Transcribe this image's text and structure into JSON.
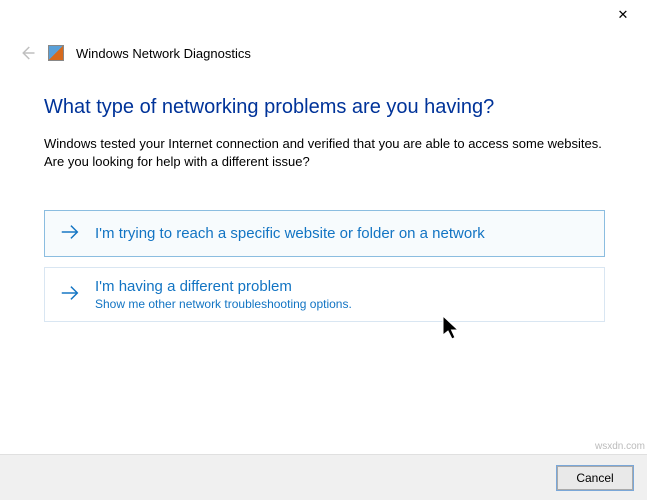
{
  "window": {
    "title": "Windows Network Diagnostics",
    "close_glyph": "✕"
  },
  "heading": "What type of networking problems are you having?",
  "subtext": "Windows tested your Internet connection and verified that you are able to access some websites. Are you looking for help with a different issue?",
  "options": [
    {
      "title": "I'm trying to reach a specific website or folder on a network",
      "subtitle": "",
      "selected": true
    },
    {
      "title": "I'm having a different problem",
      "subtitle": "Show me other network troubleshooting options.",
      "selected": false
    }
  ],
  "footer": {
    "cancel": "Cancel"
  },
  "watermark": "wsxdn.com"
}
